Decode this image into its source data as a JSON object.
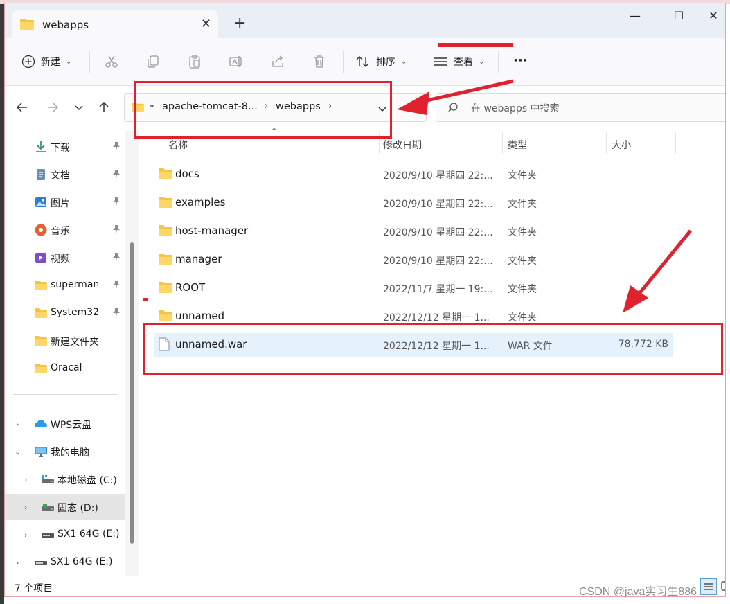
{
  "window": {
    "tab_title": "webapps",
    "new_tab_label": "+",
    "minimize_label": "—",
    "maximize_label": "☐",
    "close_label": "✕"
  },
  "toolbar": {
    "new_label": "新建",
    "sort_label": "排序",
    "view_label": "查看",
    "more_label": "···"
  },
  "address": {
    "overflow": "«",
    "crumbs": [
      "apache-tomcat-8...",
      "webapps"
    ],
    "search_placeholder": "在 webapps 中搜索"
  },
  "sidebar": {
    "quick_access": [
      {
        "label": "下载",
        "icon": "download-icon",
        "pinned": true
      },
      {
        "label": "文档",
        "icon": "document-icon",
        "pinned": true
      },
      {
        "label": "图片",
        "icon": "picture-icon",
        "pinned": true
      },
      {
        "label": "音乐",
        "icon": "music-icon",
        "pinned": true
      },
      {
        "label": "视频",
        "icon": "video-icon",
        "pinned": true
      },
      {
        "label": "superman",
        "icon": "folder-icon",
        "pinned": true
      },
      {
        "label": "System32",
        "icon": "folder-icon",
        "pinned": true
      },
      {
        "label": "新建文件夹",
        "icon": "folder-icon",
        "pinned": false
      },
      {
        "label": "Oracal",
        "icon": "folder-icon",
        "pinned": false
      }
    ],
    "locations": [
      {
        "label": "WPS云盘",
        "icon": "cloud-icon",
        "expanded": false
      },
      {
        "label": "我的电脑",
        "icon": "computer-icon",
        "expanded": true
      },
      {
        "label": "本地磁盘 (C:)",
        "icon": "drive-icon",
        "expanded": false
      },
      {
        "label": "固态 (D:)",
        "icon": "drive-icon",
        "expanded": false,
        "selected": true
      },
      {
        "label": "SX1 64G (E:)",
        "icon": "drive-icon",
        "expanded": false
      },
      {
        "label": "SX1 64G (E:)",
        "icon": "drive-icon",
        "expanded": false
      }
    ]
  },
  "filelist": {
    "columns": [
      "名称",
      "修改日期",
      "类型",
      "大小"
    ],
    "rows": [
      {
        "name": "docs",
        "date": "2020/9/10 星期四 22:...",
        "type": "文件夹",
        "size": "",
        "kind": "folder"
      },
      {
        "name": "examples",
        "date": "2020/9/10 星期四 22:...",
        "type": "文件夹",
        "size": "",
        "kind": "folder"
      },
      {
        "name": "host-manager",
        "date": "2020/9/10 星期四 22:...",
        "type": "文件夹",
        "size": "",
        "kind": "folder"
      },
      {
        "name": "manager",
        "date": "2020/9/10 星期四 22:...",
        "type": "文件夹",
        "size": "",
        "kind": "folder"
      },
      {
        "name": "ROOT",
        "date": "2022/11/7 星期一 19:...",
        "type": "文件夹",
        "size": "",
        "kind": "folder"
      },
      {
        "name": "unnamed",
        "date": "2022/12/12 星期一 1...",
        "type": "文件夹",
        "size": "",
        "kind": "folder"
      },
      {
        "name": "unnamed.war",
        "date": "2022/12/12 星期一 1...",
        "type": "WAR 文件",
        "size": "78,772 KB",
        "kind": "file",
        "selected": true
      }
    ]
  },
  "status": {
    "item_count": "7 个项目"
  },
  "watermark": "CSDN @java实习生886",
  "colors": {
    "annotation": "#e0212e",
    "selection": "#e5f1fb",
    "folder": "#f6c445"
  }
}
